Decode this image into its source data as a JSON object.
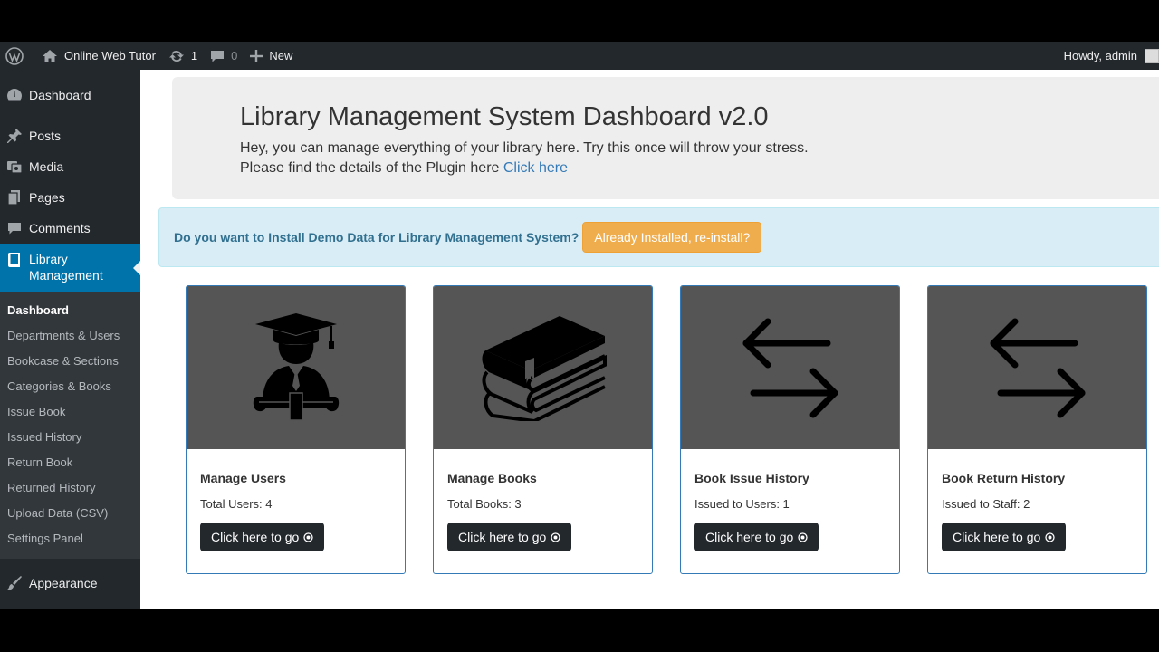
{
  "adminbar": {
    "site_name": "Online Web Tutor",
    "updates_count": "1",
    "comments_count": "0",
    "new_label": "New",
    "howdy": "Howdy, admin"
  },
  "sidebar": {
    "items_top": [
      {
        "label": "Dashboard",
        "icon": "dashboard-icon"
      },
      {
        "label": "Posts",
        "icon": "pin-icon"
      },
      {
        "label": "Media",
        "icon": "media-icon"
      },
      {
        "label": "Pages",
        "icon": "pages-icon"
      },
      {
        "label": "Comments",
        "icon": "comment-icon"
      }
    ],
    "current_label_line1": "Library",
    "current_label_line2": "Management",
    "submenu": [
      "Dashboard",
      "Departments & Users",
      "Bookcase & Sections",
      "Categories & Books",
      "Issue Book",
      "Issued History",
      "Return Book",
      "Returned History",
      "Upload Data (CSV)",
      "Settings Panel"
    ],
    "appearance_label": "Appearance"
  },
  "jumbotron": {
    "title": "Library Management System Dashboard v2.0",
    "line1": "Hey, you can manage everything of your library here. Try this once will throw your stress.",
    "line2_prefix": "Please find the details of the Plugin here ",
    "line2_link": "Click here"
  },
  "alert": {
    "text": "Do you want to Install Demo Data for Library Management System?",
    "button": "Already Installed, re-install?"
  },
  "cards": [
    {
      "title": "Manage Users",
      "stat": "Total Users: 4",
      "button": "Click here to go",
      "icon": "graduate-icon"
    },
    {
      "title": "Manage Books",
      "stat": "Total Books: 3",
      "button": "Click here to go",
      "icon": "books-icon"
    },
    {
      "title": "Book Issue History",
      "stat": "Issued to Users: 1",
      "button": "Click here to go",
      "icon": "exchange-icon"
    },
    {
      "title": "Book Return History",
      "stat": "Issued to Staff: 2",
      "button": "Click here to go",
      "icon": "exchange-icon"
    }
  ],
  "colors": {
    "admin_bar": "#23282d",
    "sidebar_current": "#0073aa",
    "alert_bg": "#d9edf7",
    "warning_button": "#f0ad4e",
    "card_image_bg": "#555555",
    "card_border": "#337ab7"
  }
}
